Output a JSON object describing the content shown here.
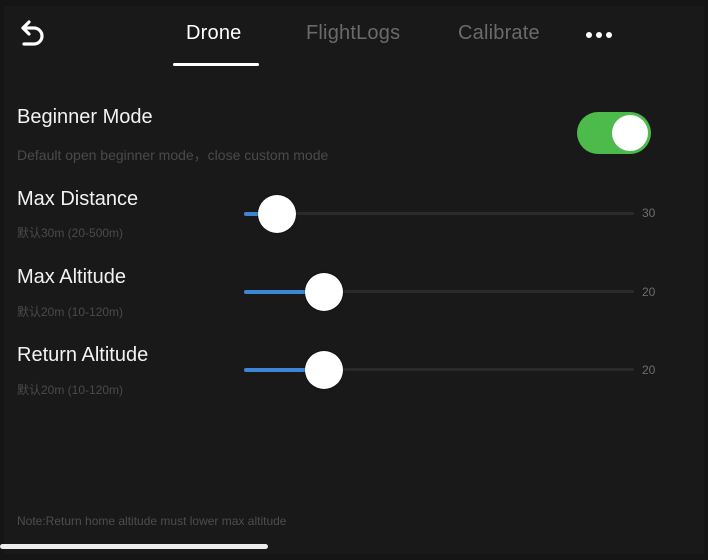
{
  "header": {
    "back_icon": "back-arrow-icon",
    "tabs": [
      {
        "label": "Drone",
        "active": true
      },
      {
        "label": "FlightLogs",
        "active": false
      },
      {
        "label": "Calibrate",
        "active": false
      }
    ],
    "more_icon": "more-dots-icon"
  },
  "beginner_mode": {
    "title": "Beginner Mode",
    "subtitle": "Default open beginner mode，close custom mode",
    "enabled": true
  },
  "settings": {
    "max_distance": {
      "label": "Max Distance",
      "hint": "默认30m (20-500m)",
      "value": "30",
      "min": 20,
      "max": 500,
      "current": 30
    },
    "max_altitude": {
      "label": "Max Altitude",
      "hint": "默认20m (10-120m)",
      "value": "20",
      "min": 10,
      "max": 120,
      "current": 20
    },
    "return_altitude": {
      "label": "Return Altitude",
      "hint": "默认20m (10-120m)",
      "value": "20",
      "min": 10,
      "max": 120,
      "current": 20
    }
  },
  "note": "Note:Return home altitude must lower max altitude",
  "colors": {
    "background": "#191919",
    "toggle_on": "#4cbb4c",
    "slider_fill": "#3d86d6",
    "tab_inactive": "#6a6a6a"
  }
}
